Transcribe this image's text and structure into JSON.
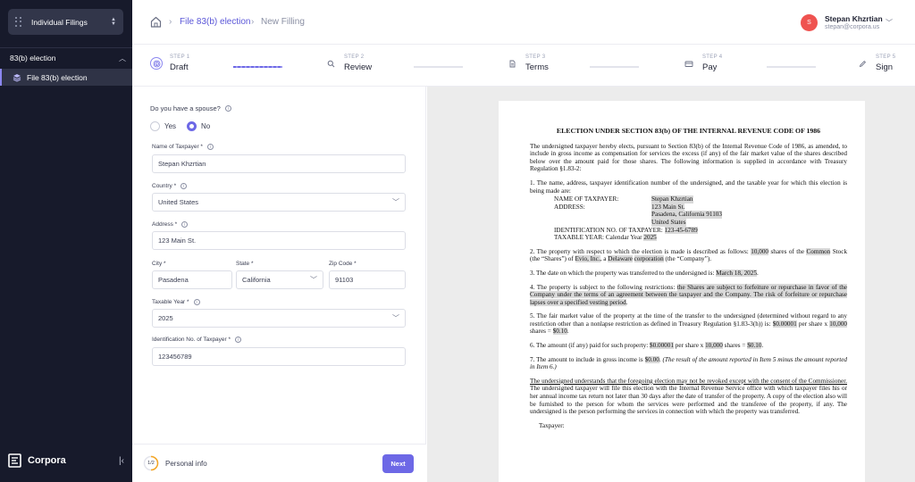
{
  "sidebar": {
    "filings_select": "Individual Filings",
    "section_label": "83(b) election",
    "item_label": "File 83(b) election",
    "brand_name": "Corpora",
    "accent": "#8b87f0"
  },
  "header": {
    "breadcrumb_link": "File 83(b) election",
    "breadcrumb_current": "New Filling",
    "avatar_initial": "S",
    "user_name": "Stepan Khzrtian",
    "user_email": "stepan@corpora.us"
  },
  "steps": [
    {
      "num": "STEP 1",
      "name": "Draft",
      "icon": "fingerprint-icon"
    },
    {
      "num": "STEP 2",
      "name": "Review",
      "icon": "search-icon"
    },
    {
      "num": "STEP 3",
      "name": "Terms",
      "icon": "document-icon"
    },
    {
      "num": "STEP 4",
      "name": "Pay",
      "icon": "card-icon"
    },
    {
      "num": "STEP 5",
      "name": "Sign",
      "icon": "pen-icon"
    }
  ],
  "form": {
    "spouse_question": "Do you have a spouse?",
    "yes_label": "Yes",
    "no_label": "No",
    "name_label": "Name of Taxpayer *",
    "name_value": "Stepan Khzrtian",
    "country_label": "Country *",
    "country_value": "United States",
    "address_label": "Address *",
    "address_value": "123 Main St.",
    "city_label": "City *",
    "city_value": "Pasadena",
    "state_label": "State *",
    "state_value": "California",
    "zip_label": "Zip Code *",
    "zip_value": "91103",
    "year_label": "Taxable Year *",
    "year_value": "2025",
    "id_label": "Identification No. of Taxpayer *",
    "id_value": "123456789"
  },
  "footer": {
    "progress": "1/2",
    "progress_label": "Personal info",
    "next_label": "Next"
  },
  "document": {
    "title": "ELECTION UNDER SECTION 83(b) OF THE INTERNAL REVENUE CODE OF 1986",
    "intro": "The undersigned taxpayer hereby elects, pursuant to Section 83(b) of the Internal Revenue Code of 1986, as amended, to include in gross income as compensation for services the excess (if any) of the fair market value of the shares described below over the amount paid for those shares. The following information is supplied in accordance with Treasury Regulation §1.83-2:",
    "item1_text": "1. The name, address, taxpayer identification number of the undersigned, and the taxable year for which this election is being made are:",
    "name_key": "NAME OF TAXPAYER:",
    "name_val": "Stepan Khzrtian",
    "address_key": "ADDRESS:",
    "address_line1": "123 Main St.",
    "address_line2": "Pasadena, California 91103",
    "address_line3": "United States",
    "id_key": "IDENTIFICATION NO. OF TAXPAYER:",
    "id_val": "123-45-6789",
    "year_key": "TAXABLE YEAR:  Calendar Year",
    "year_val": "2025",
    "item2_a": "2. The property with respect to which the election is made is described as follows:",
    "item2_shares": "10,000",
    "item2_b": "shares of the",
    "item2_class": "Common",
    "item2_c": "Stock (the “Shares”) of",
    "item2_company": "Evio, Inc.",
    "item2_d": ", a",
    "item2_state": "Delaware",
    "item2_entity": "corporation",
    "item2_e": "(the “Company”).",
    "item3_a": "3. The date on which the property was transferred to the undersigned is:",
    "item3_date": "March 18, 2025",
    "item4_a": "4. The property is subject to the following restrictions:",
    "item4_restr": "the Shares are subject to forfeiture or repurchase in favor of the Company under the terms of an agreement between the taxpayer and the Company. The risk of forfeiture or repurchase lapses over a specified vesting period",
    "item5_a": "5. The fair market value of the property at the time of the transfer to the undersigned (determined without regard to any restriction other than a nonlapse restriction as defined in Treasury Regulation §1.83-3(h)) is:",
    "item5_price": "$0.00001",
    "item5_b": "per share x",
    "item5_shares": "10,000",
    "item5_c": "shares =",
    "item5_total": "$0.10",
    "item6_a": "6. The amount (if any) paid for such property:",
    "item6_price": "$0.00001",
    "item6_b": "per share x",
    "item6_shares": "10,000",
    "item6_c": "shares =",
    "item6_total": "$0.10",
    "item7_a": "7. The amount to include in gross income is",
    "item7_val": "$0.00",
    "item7_note": "(The result of the amount reported in Item 5 minus the amount reported in Item 6.)",
    "closing_underlined": "The undersigned understands that the foregoing election may not be revoked except with the consent of the Commissioner.",
    "closing_rest": "The undersigned taxpayer will file this election with the Internal Revenue Service office with which taxpayer files his or her annual income tax return not later than 30 days after the date of transfer of the property. A copy of the election also will be furnished to the person for whom the services were performed and the transferee of the property, if any. The undersigned is the person performing the services in connection with which the property was transferred.",
    "taxpayer_label": "Taxpayer:"
  }
}
